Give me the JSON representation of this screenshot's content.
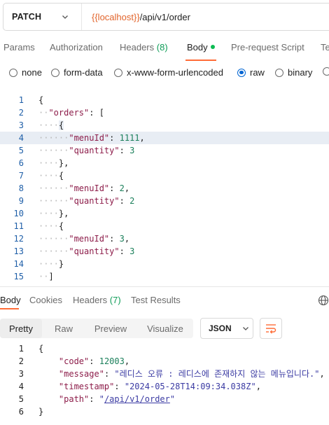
{
  "request": {
    "method": "PATCH",
    "url_variable": "{{localhost}}",
    "url_path": "/api/v1/order"
  },
  "tabs": {
    "params": "Params",
    "authorization": "Authorization",
    "headers": "Headers",
    "headers_count": "(8)",
    "body": "Body",
    "prerequest": "Pre-request Script",
    "tests": "Te"
  },
  "body_types": {
    "none": "none",
    "form_data": "form-data",
    "urlencoded": "x-www-form-urlencoded",
    "raw": "raw",
    "binary": "binary"
  },
  "request_body": {
    "line_numbers": [
      "1",
      "2",
      "3",
      "4",
      "5",
      "6",
      "7",
      "8",
      "9",
      "10",
      "11",
      "12",
      "13",
      "14",
      "15"
    ],
    "key_orders": "\"orders\"",
    "key_menuId": "\"menuId\"",
    "key_quantity": "\"quantity\"",
    "items": [
      {
        "menuId": "1111",
        "quantity": "3"
      },
      {
        "menuId": "2",
        "quantity": "2"
      },
      {
        "menuId": "3",
        "quantity": "3"
      }
    ]
  },
  "response_tabs": {
    "body": "Body",
    "cookies": "Cookies",
    "headers": "Headers",
    "headers_count": "(7)",
    "test_results": "Test Results"
  },
  "view_modes": {
    "pretty": "Pretty",
    "raw": "Raw",
    "preview": "Preview",
    "visualize": "Visualize",
    "format": "JSON"
  },
  "response_body": {
    "line_numbers": [
      "1",
      "2",
      "3",
      "4",
      "5",
      "6"
    ],
    "key_code": "\"code\"",
    "value_code": "12003",
    "key_message": "\"message\"",
    "value_message": "\"레디스 오류 : 레디스에 존재하지 않는 메뉴입니다.\"",
    "key_timestamp": "\"timestamp\"",
    "value_timestamp": "\"2024-05-28T14:09:34.038Z\"",
    "key_path": "\"path\"",
    "value_path": "/api/v1/order"
  },
  "colors": {
    "accent": "#ff6c37",
    "url_variable": "#e2642b",
    "radio_selected": "#0265d2",
    "json_key": "#8d1d4a",
    "json_string": "#3b3ba3",
    "json_number": "#1a7f5a"
  }
}
